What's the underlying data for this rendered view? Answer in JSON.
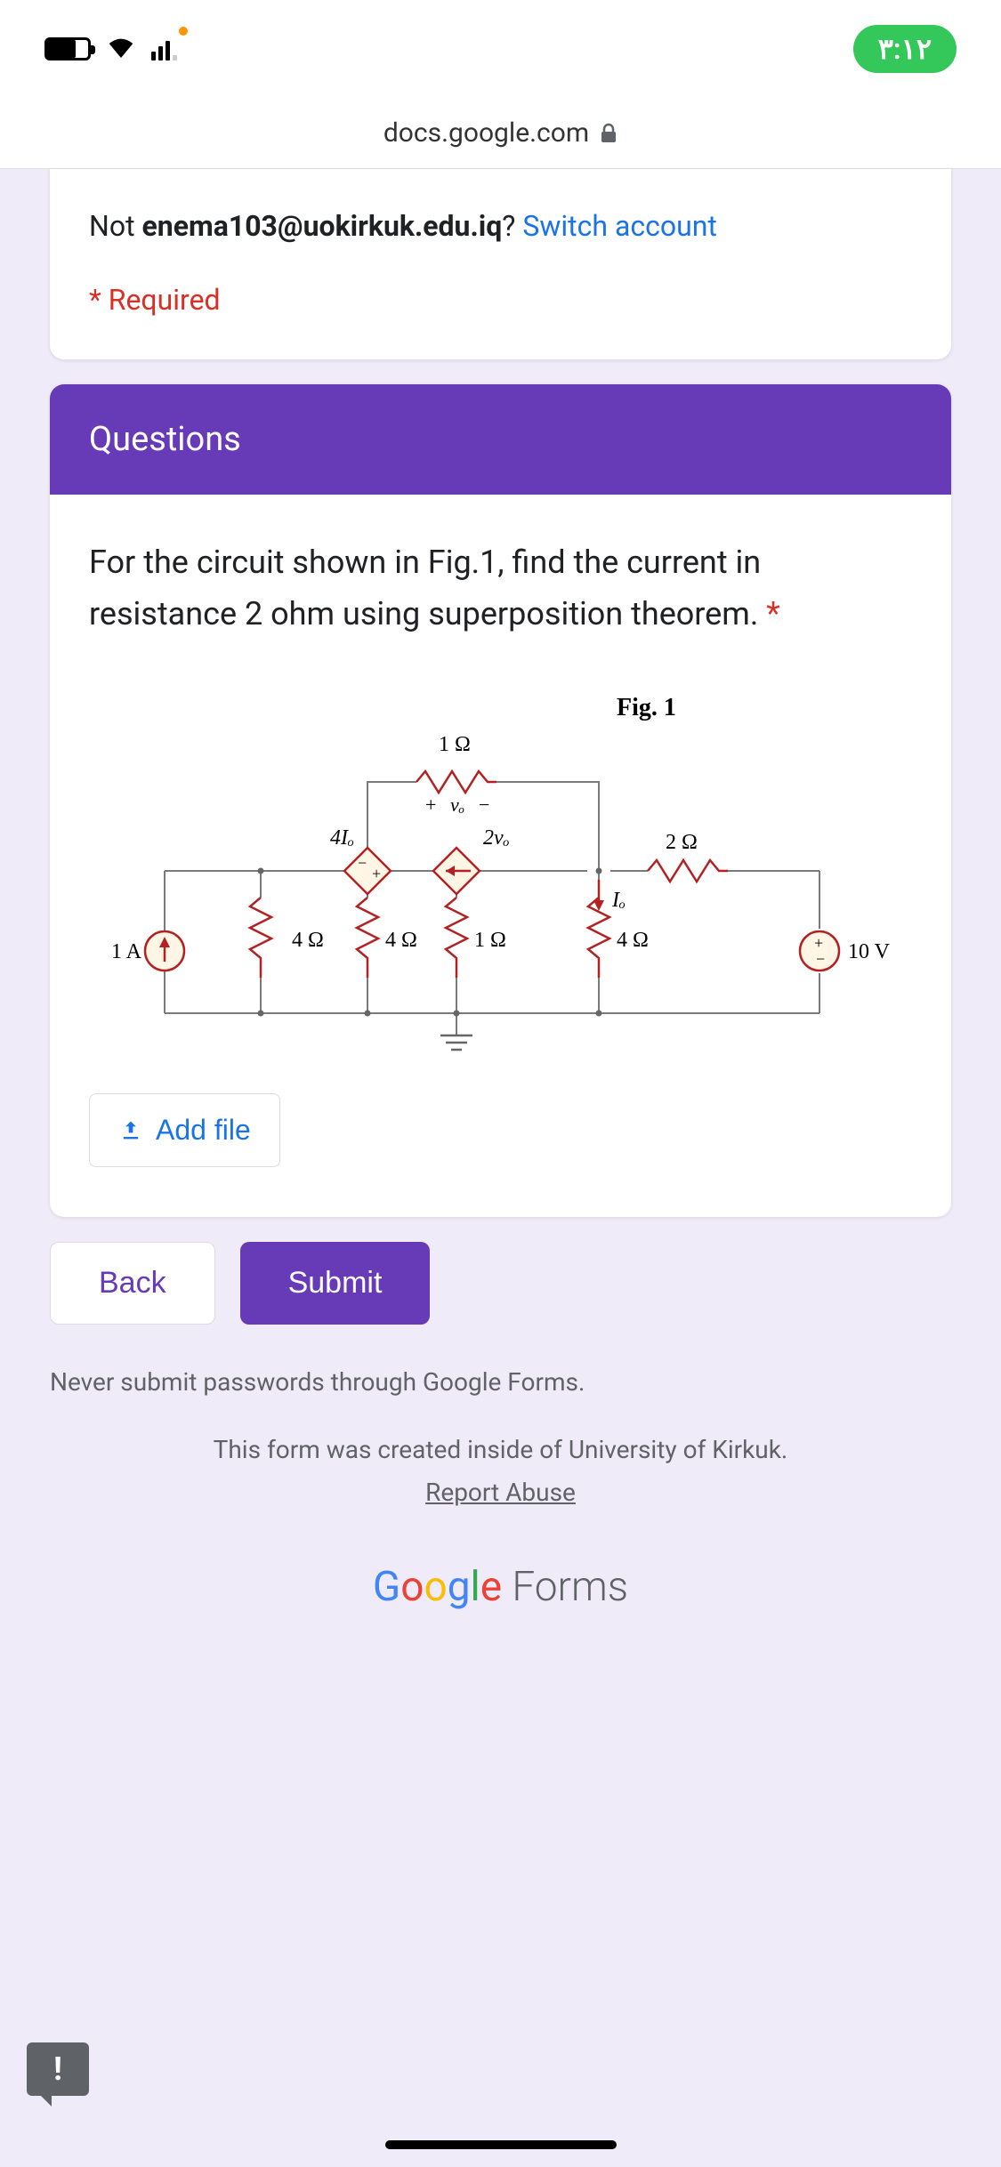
{
  "status": {
    "time": "٣:١٢"
  },
  "url": "docs.google.com",
  "header": {
    "not_prefix": "Not ",
    "email": "enema103@uokirkuk.edu.iq",
    "q_mark": "? ",
    "switch_link": "Switch account",
    "required_note": "* Required"
  },
  "section": {
    "title": "Questions"
  },
  "question": {
    "text": "For the circuit shown in Fig.1, find the current in resistance 2 ohm using superposition theorem. ",
    "required_star": "*"
  },
  "circuit": {
    "fig_label": "Fig. 1",
    "r_top": "1 Ω",
    "v_top": "vₒ",
    "src_left_label": "4Iₒ",
    "src_right_label": "2vₒ",
    "r_top_right": "2 Ω",
    "i_label": "Iₒ",
    "current_src": "1 A",
    "r_b1": "4 Ω",
    "r_b2": "4 Ω",
    "r_bm": "1 Ω",
    "r_b4": "4 Ω",
    "volt_src": "10 V"
  },
  "buttons": {
    "add_file": "Add file",
    "back": "Back",
    "submit": "Submit"
  },
  "footer": {
    "warning": "Never submit passwords through Google Forms.",
    "org_notice": "This form was created inside of University of Kirkuk.",
    "report_abuse": "Report Abuse",
    "logo_forms": " Forms"
  }
}
